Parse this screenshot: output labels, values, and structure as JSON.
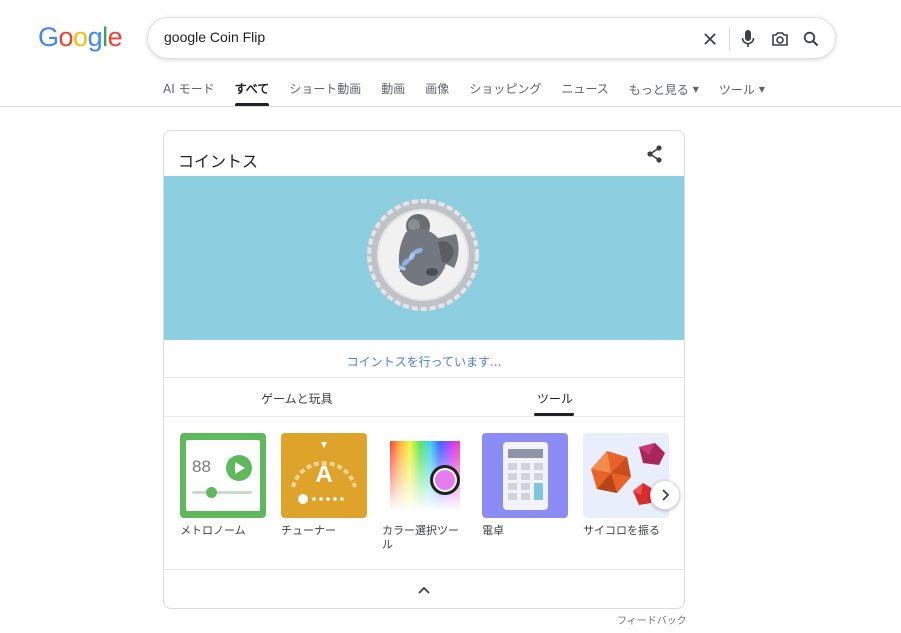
{
  "logo": {
    "letters": [
      "G",
      "o",
      "o",
      "g",
      "l",
      "e"
    ],
    "colors": [
      "#4285F4",
      "#EA4335",
      "#FBBC05",
      "#4285F4",
      "#34A853",
      "#EA4335"
    ]
  },
  "search": {
    "query": "google Coin Flip"
  },
  "tabs": [
    {
      "label": "AI モード"
    },
    {
      "label": "すべて",
      "active": true
    },
    {
      "label": "ショート動画"
    },
    {
      "label": "動画"
    },
    {
      "label": "画像"
    },
    {
      "label": "ショッピング"
    },
    {
      "label": "ニュース"
    },
    {
      "label": "もっと見る",
      "dropdown": true
    },
    {
      "label": "ツール",
      "dropdown": true
    }
  ],
  "card": {
    "title": "コイントス",
    "status": "コイントスを行っています...",
    "stage_color": "#8ccfe0",
    "subtabs": [
      "ゲームと玩具",
      "ツール"
    ],
    "active_subtab": "ツール",
    "tools": [
      {
        "label": "メトロノーム",
        "icon": "metronome-icon",
        "color": "#5fb95c",
        "value": "88"
      },
      {
        "label": "チューナー",
        "icon": "tuner-icon",
        "color": "#dea32b",
        "value": "A"
      },
      {
        "label": "カラー選択ツール",
        "icon": "color-picker-icon",
        "color": "#ffffff"
      },
      {
        "label": "電卓",
        "icon": "calculator-icon",
        "color": "#8c8cf5"
      },
      {
        "label": "サイコロを振る",
        "icon": "dice-icon",
        "color": "#e8eefc"
      }
    ]
  },
  "feedback": "フィードバック"
}
